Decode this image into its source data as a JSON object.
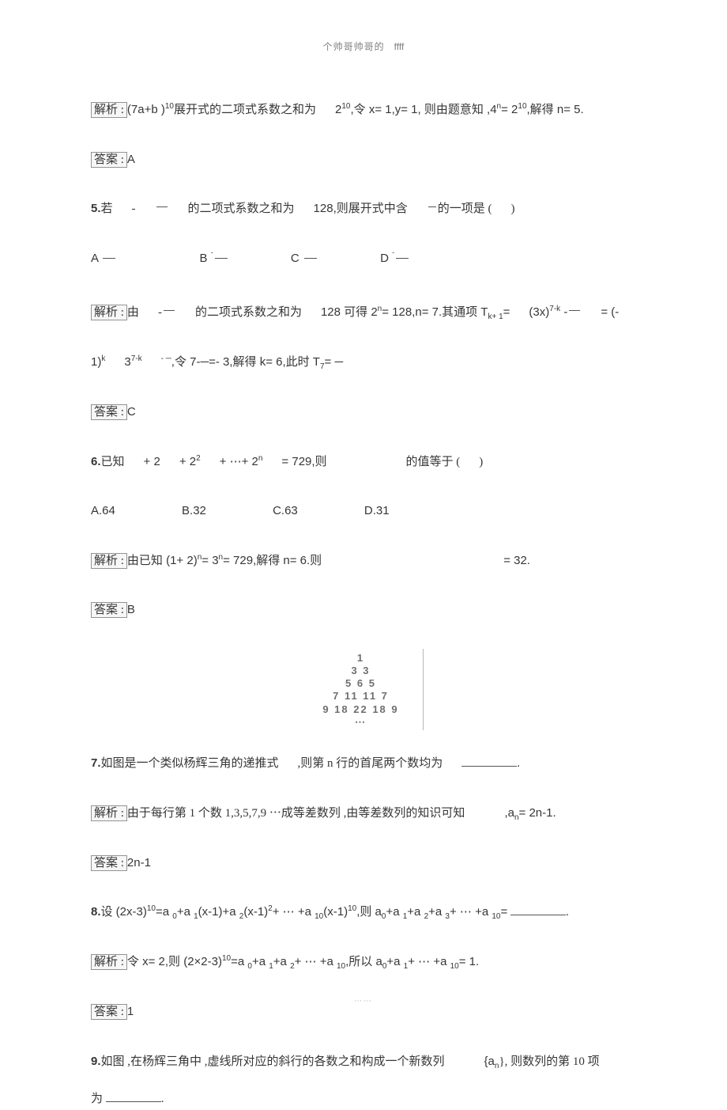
{
  "header": {
    "left": "个帅哥帅哥的",
    "right": "ffff"
  },
  "footer": "⋯⋯",
  "q4": {
    "jiexi_label": "解析 :",
    "jiexi_text_a": "(7a+b )",
    "jiexi_exp": "10",
    "jiexi_text_b": "展开式的二项式系数之和为",
    "jiexi_text_c": "2",
    "jiexi_exp2": "10",
    "jiexi_text_d": ",令 x= 1,y= 1, 则由题意知  ,4",
    "jiexi_exp3": "n",
    "jiexi_text_e": "= 2",
    "jiexi_exp4": "10",
    "jiexi_text_f": ",解得  n= 5.",
    "daan_label": "答案 :",
    "daan_val": "A"
  },
  "q5": {
    "num": "5.",
    "text_a": "若",
    "text_b": "的二项式系数之和为",
    "text_c": "128,则展开式中含",
    "text_d": "的一项是 (",
    "text_e": ")",
    "optA": "A",
    "optB": "B",
    "optC": "C",
    "optD": "D",
    "jiexi_label": "解析 :",
    "jx_a": "由",
    "jx_b": "的二项式系数之和为",
    "jx_c": "128 可得  2",
    "jx_c_exp": "n",
    "jx_d": "= 128,n= 7.其通项  T",
    "jx_d_sub": "k+ 1",
    "jx_e": "=",
    "jx_f": "(3x)",
    "jx_f_exp": "7-k",
    "jx_g": " -",
    "jx_h": "= (-",
    "line2_a": "1)",
    "line2_a_exp": "k",
    "line2_b": "3",
    "line2_b_exp": "7-k",
    "line2_neg": "- ─",
    "line2_c": ",令 7-─=- 3,解得  k= 6,此时  T",
    "line2_c_sub": "7",
    "line2_d": "= ─",
    "daan_label": "答案 :",
    "daan_val": "C"
  },
  "q6": {
    "num": "6.",
    "text_a": "已知",
    "text_b": "+ 2",
    "text_c": "+ 2",
    "text_c_exp": "2",
    "text_d": "+ ⋯+ 2",
    "text_d_exp": "n",
    "text_e": "= 729,则",
    "text_f": "的值等于 (",
    "text_g": ")",
    "optA": "A.64",
    "optB": "B.32",
    "optC": "C.63",
    "optD": "D.31",
    "jiexi_label": "解析 :",
    "jx_a": "由已知 (1+ 2)",
    "jx_a_exp": "n",
    "jx_b": "= 3",
    "jx_b_exp": "n",
    "jx_c": "= 729,解得  n= 6.则",
    "jx_d": "= 32.",
    "daan_label": "答案 :",
    "daan_val": "B"
  },
  "triangle": {
    "r1": "1",
    "r2": "3   3",
    "r3": "5   6   5",
    "r4": "7  11  11  7",
    "r5": "9  18  22  18  9",
    "r6": "⋯"
  },
  "q7": {
    "num": "7.",
    "text_a": "如图是一个类似杨辉三角的递推式",
    "text_b": ",则第  n 行的首尾两个数均为",
    "jiexi_label": "解析 :",
    "jx": "由于每行第   1 个数  1,3,5,7,9 ⋯成等差数列   ,由等差数列的知识可知",
    "jx_b": ",a",
    "jx_b_sub": "n",
    "jx_c": "= 2n-1.",
    "daan_label": "答案 :",
    "daan_val": "2n-1"
  },
  "q8": {
    "num": "8.",
    "text_a": "设 (2x-3)",
    "text_a_exp": "10",
    "text_b": "=a ",
    "s0": "0",
    "text_c": "+a ",
    "s1": "1",
    "text_d": "(x-1)+a ",
    "s2": "2",
    "text_e": "(x-1)",
    "e2": "2",
    "text_f": "+ ⋯ +a ",
    "s10": "10",
    "text_g": "(x-1)",
    "e10": "10",
    "text_h": ",则  a",
    "text_i": "+a ",
    "text_j": "+a ",
    "text_k": "+a ",
    "text_l": "+ ⋯ +a ",
    "text_m": "=",
    "jiexi_label": "解析 :",
    "jx_a": "令  x= 2,则 (2×2-3)",
    "jx_a_exp": "10",
    "jx_b": "=a ",
    "jx_c": "+a ",
    "jx_d": "+a ",
    "jx_e": "+ ⋯ +a ",
    "jx_f": ",所以  a",
    "jx_g": "+a ",
    "jx_h": "+ ⋯ +a ",
    "jx_i": "= 1.",
    "daan_label": "答案 :",
    "daan_val": "1"
  },
  "q9": {
    "num": "9.",
    "text_a": "如图 ,在杨辉三角中   ,虚线所对应的斜行的各数之和构成一个新数列",
    "text_b": "{a",
    "text_b_sub": "n",
    "text_c": "}, 则数列的第   10 项",
    "text_d": "为",
    "period": "."
  }
}
